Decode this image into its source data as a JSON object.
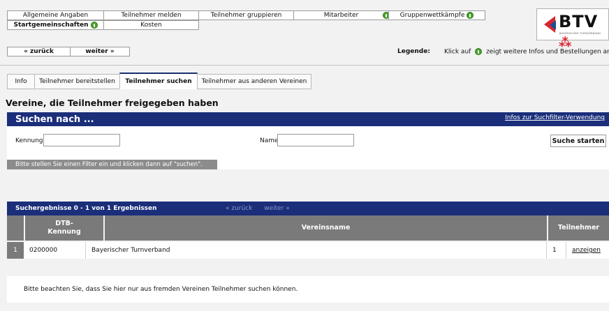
{
  "nav": {
    "row1": [
      {
        "label": "Allgemeine Angaben",
        "info": false
      },
      {
        "label": "Teilnehmer melden",
        "info": false
      },
      {
        "label": "Teilnehmer gruppieren",
        "info": false
      },
      {
        "label": "Mitarbeiter",
        "info": true
      },
      {
        "label": "Gruppenwettkämpfe",
        "info": true
      }
    ],
    "row2": [
      {
        "label": "Startgemeinschaften",
        "info": true,
        "bold": true
      },
      {
        "label": "Kosten",
        "info": false
      }
    ]
  },
  "logo": {
    "text": "BTV",
    "subtitle": "BAYERISCHER TURNVERBAND"
  },
  "pager": {
    "back": "« zurück",
    "forward": "weiter »"
  },
  "legend": {
    "label": "Legende:",
    "text_before": "Klick auf",
    "text_after": "zeigt weitere Infos und Bestellungen an"
  },
  "tabs": [
    {
      "label": "Info",
      "active": false
    },
    {
      "label": "Teilnehmer bereitstellen",
      "active": false
    },
    {
      "label": "Teilnehmer suchen",
      "active": true
    },
    {
      "label": "Teilnehmer aus anderen Vereinen",
      "active": false
    }
  ],
  "page_title": "Vereine, die Teilnehmer freigegeben haben",
  "search": {
    "title": "Suchen nach ...",
    "help_link": "Infos zur Suchfilter-Verwendung",
    "kennung_label": "Kennung",
    "kennung_value": "",
    "name_label": "Name",
    "name_value": "",
    "button": "Suche starten",
    "status": "Bitte stellen Sie einen Filter ein und klicken dann auf \"suchen\"."
  },
  "results": {
    "count_text": "Suchergebnisse 0 - 1 von 1 Ergebnissen",
    "nav_back": "« zurück",
    "nav_forward": "weiter »",
    "columns": {
      "dtb": "DTB-\nKennung",
      "name": "Vereinsname",
      "members": "Teilnehmer"
    },
    "rows": [
      {
        "num": "1",
        "kennung": "0200000",
        "name": "Bayerischer Turnverband",
        "count": "1",
        "action": "anzeigen"
      }
    ]
  },
  "note": "Bitte beachten Sie, dass Sie hier nur aus fremden Vereinen Teilnehmer suchen können.",
  "colors": {
    "header_blue": "#1a2e7a",
    "gray": "#7a7a7a",
    "info_green": "#49a12c",
    "brand_red": "#d8262f"
  }
}
